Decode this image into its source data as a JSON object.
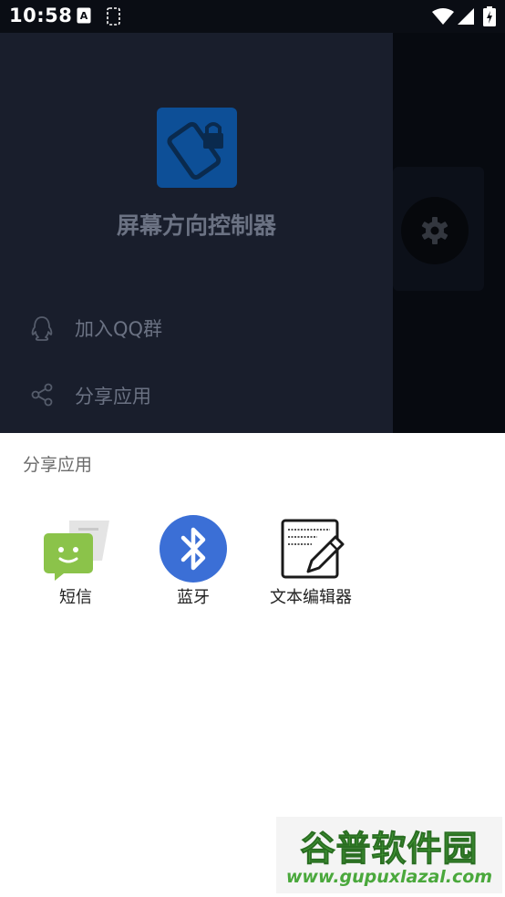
{
  "status_bar": {
    "time": "10:58",
    "icons": [
      "font-notification-icon",
      "screenshot-notification-icon",
      "wifi-icon",
      "signal-icon",
      "battery-icon"
    ]
  },
  "app": {
    "title": "屏幕方向控制器",
    "icon": "rotation-lock-icon",
    "drawer_items": [
      {
        "icon": "qq-icon",
        "label": "加入QQ群"
      },
      {
        "icon": "share-icon",
        "label": "分享应用"
      }
    ],
    "main_button_icon": "gear-icon"
  },
  "share_sheet": {
    "title": "分享应用",
    "targets": [
      {
        "icon": "messages-icon",
        "label": "短信"
      },
      {
        "icon": "bluetooth-icon",
        "label": "蓝牙"
      },
      {
        "icon": "text-editor-icon",
        "label": "文本编辑器"
      }
    ]
  },
  "watermark": {
    "title": "谷普软件园",
    "url": "www.gupuxlazal.com"
  },
  "colors": {
    "status_bar_bg": "#0a0d14",
    "drawer_bg": "#191e2c",
    "app_icon_bg": "#0d4f97",
    "bluetooth_blue": "#3b6fd6",
    "messages_green": "#8bc34a",
    "watermark_green": "#4aa83c"
  }
}
